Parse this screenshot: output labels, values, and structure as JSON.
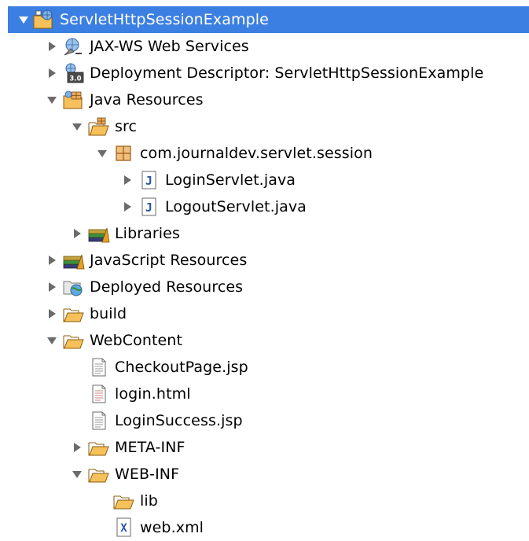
{
  "colors": {
    "selection": "#3c7fe3",
    "folder_fill": "#f6c15a",
    "folder_stroke": "#b07d18",
    "twisty": "#6b6b6b"
  },
  "tree": {
    "root": {
      "label": "ServletHttpSessionExample",
      "expanded": true,
      "selected": true,
      "icon": "web-project-icon"
    },
    "jaxws": {
      "label": "JAX-WS Web Services",
      "expanded": false,
      "icon": "web-services-icon"
    },
    "deployment_descriptor": {
      "label": "Deployment Descriptor: ServletHttpSessionExample",
      "expanded": false,
      "icon": "deployment-descriptor-icon",
      "badge": "3.0"
    },
    "java_resources": {
      "label": "Java Resources",
      "expanded": true,
      "icon": "java-resources-icon"
    },
    "src": {
      "label": "src",
      "expanded": true,
      "icon": "source-folder-icon"
    },
    "package": {
      "label": "com.journaldev.servlet.session",
      "expanded": true,
      "icon": "package-icon"
    },
    "login_servlet": {
      "label": "LoginServlet.java",
      "expanded": false,
      "icon": "java-file-icon",
      "glyph": "J"
    },
    "logout_servlet": {
      "label": "LogoutServlet.java",
      "expanded": false,
      "icon": "java-file-icon",
      "glyph": "J"
    },
    "libraries": {
      "label": "Libraries",
      "expanded": false,
      "icon": "libraries-icon"
    },
    "javascript_resources": {
      "label": "JavaScript Resources",
      "expanded": false,
      "icon": "javascript-resources-icon"
    },
    "deployed_resources": {
      "label": "Deployed Resources",
      "expanded": false,
      "icon": "deployed-resources-icon"
    },
    "build": {
      "label": "build",
      "expanded": false,
      "icon": "folder-icon"
    },
    "webcontent": {
      "label": "WebContent",
      "expanded": true,
      "icon": "folder-open-icon"
    },
    "checkout_page": {
      "label": "CheckoutPage.jsp",
      "icon": "jsp-file-icon"
    },
    "login_html": {
      "label": "login.html",
      "icon": "html-file-icon"
    },
    "login_success": {
      "label": "LoginSuccess.jsp",
      "icon": "jsp-file-icon"
    },
    "meta_inf": {
      "label": "META-INF",
      "expanded": false,
      "icon": "folder-icon"
    },
    "web_inf": {
      "label": "WEB-INF",
      "expanded": true,
      "icon": "folder-open-icon"
    },
    "lib": {
      "label": "lib",
      "icon": "folder-icon"
    },
    "web_xml": {
      "label": "web.xml",
      "icon": "xml-file-icon",
      "glyph": "X"
    }
  }
}
